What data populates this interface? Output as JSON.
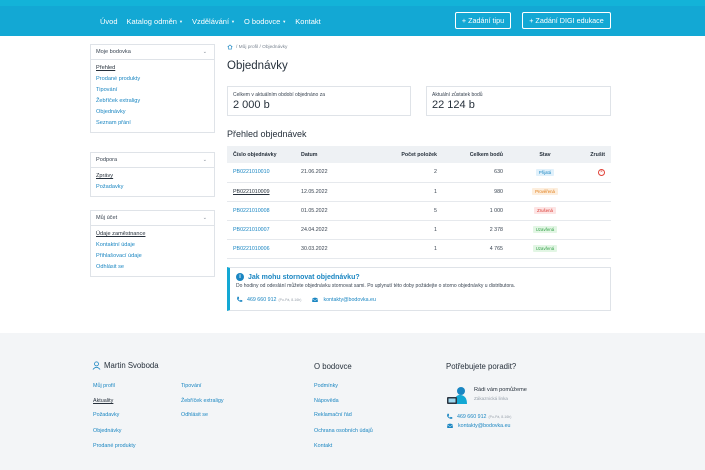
{
  "nav": {
    "items": [
      {
        "label": "Úvod",
        "dropdown": false
      },
      {
        "label": "Katalog odměn",
        "dropdown": true
      },
      {
        "label": "Vzdělávání",
        "dropdown": true
      },
      {
        "label": "O bodovce",
        "dropdown": true
      },
      {
        "label": "Kontakt",
        "dropdown": false
      }
    ],
    "btn_tip": "+ Zadání tipu",
    "btn_digi": "+ Zadání DIGI edukace"
  },
  "sidebar": {
    "box1": {
      "title": "Moje bodovka",
      "items": [
        {
          "label": "Přehled",
          "active": true
        },
        {
          "label": "Prodané produkty",
          "active": false
        },
        {
          "label": "Tipování",
          "active": false
        },
        {
          "label": "Žebříček extraligy",
          "active": false
        },
        {
          "label": "Objednávky",
          "active": false
        },
        {
          "label": "Seznam přání",
          "active": false
        }
      ]
    },
    "box2": {
      "title": "Podpora",
      "items": [
        {
          "label": "Zprávy",
          "active": true
        },
        {
          "label": "Požadavky",
          "active": false
        }
      ]
    },
    "box3": {
      "title": "Můj účet",
      "items": [
        {
          "label": "Údaje zaměstnance",
          "active": true
        },
        {
          "label": "Kontaktní údaje",
          "active": false
        },
        {
          "label": "Přihlašovací údaje",
          "active": false
        },
        {
          "label": "Odhlásit se",
          "active": false
        }
      ]
    }
  },
  "breadcrumb": {
    "path": "/ Můj profil / Objednávky"
  },
  "page": {
    "title": "Objednávky",
    "stat1_label": "Celkem v aktuálním období objednáno za",
    "stat1_value": "2 000 b",
    "stat2_label": "Aktuální zůstatek bodů",
    "stat2_value": "22 124 b",
    "subtitle": "Přehled objednávek"
  },
  "table": {
    "headers": {
      "number": "Číslo objednávky",
      "date": "Datum",
      "count": "Počet položek",
      "points": "Celkem bodů",
      "status": "Stav",
      "cancel": "Zrušit"
    },
    "rows": [
      {
        "number": "PB0221010010",
        "date": "21.06.2022",
        "count": "2",
        "points": "630",
        "status": "Přijatá",
        "status_kind": "received",
        "cancelable": true,
        "underline": false
      },
      {
        "number": "PB0221010009",
        "date": "12.05.2022",
        "count": "1",
        "points": "980",
        "status": "Prověřená",
        "status_kind": "checked",
        "cancelable": false,
        "underline": true
      },
      {
        "number": "PB0221010008",
        "date": "01.05.2022",
        "count": "5",
        "points": "1 000",
        "status": "Zrušená",
        "status_kind": "cancelled",
        "cancelable": false,
        "underline": false
      },
      {
        "number": "PB0221010007",
        "date": "24.04.2022",
        "count": "1",
        "points": "2 378",
        "status": "Uzavřená",
        "status_kind": "closed",
        "cancelable": false,
        "underline": false
      },
      {
        "number": "PB0221010006",
        "date": "30.03.2022",
        "count": "1",
        "points": "4 765",
        "status": "Uzavřená",
        "status_kind": "closed",
        "cancelable": false,
        "underline": false
      }
    ]
  },
  "status_colors": {
    "received": {
      "bg": "#e1f1fb",
      "fg": "#1a86c2"
    },
    "checked": {
      "bg": "#fdeedd",
      "fg": "#e07a12"
    },
    "cancelled": {
      "bg": "#fde4e4",
      "fg": "#d9332b"
    },
    "closed": {
      "bg": "#e2f6e4",
      "fg": "#2f9e44"
    }
  },
  "info": {
    "title": "Jak mohu stornovat objednávku?",
    "text": "Do hodiny od odeslání můžete objednávku stornovat sami. Po uplynutí této doby požádejte o storno objednávky u distributora.",
    "phone": "469 660 912",
    "phone_hours": "(Po-Pá, 8-16h)",
    "email": "kontakty@bodovka.eu"
  },
  "footer": {
    "user_name": "Martin Svoboda",
    "col1": [
      "Můj profil",
      "Aktuality",
      "Požadavky",
      "Objednávky",
      "Prodané produkty"
    ],
    "col2": [
      "Tipování",
      "Žebříček extraligy",
      "Odhlásit se"
    ],
    "about_title": "O bodovce",
    "about_links": [
      "Podmínky",
      "Nápověda",
      "Reklamační řád",
      "Ochrana osobních údajů",
      "Kontakt"
    ],
    "help_title": "Potřebujete poradit?",
    "help_text": "Rádi vám pomůžeme",
    "help_sub": "Zákaznická linka",
    "phone": "469 660 912",
    "phone_hours": "(Po-Pá, 8-16h)",
    "email": "kontakty@bodovka.eu"
  },
  "colors": {
    "accent": "#13a8d4",
    "link": "#1a86c2"
  }
}
